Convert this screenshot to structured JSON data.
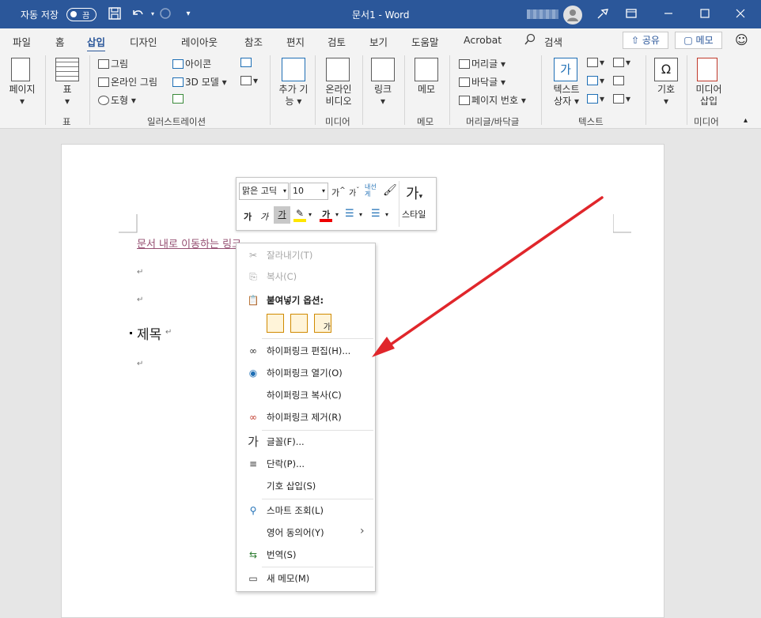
{
  "titlebar": {
    "autosave": "자동 저장",
    "toggle": "끔",
    "title": "문서1  -  Word",
    "bg": "#2b579a"
  },
  "tabs": {
    "items": [
      "파일",
      "홈",
      "삽입",
      "디자인",
      "레이아웃",
      "참조",
      "편지",
      "검토",
      "보기",
      "도움말",
      "Acrobat"
    ],
    "search": "검색",
    "share": "공유",
    "memo": "메모"
  },
  "ribbon": {
    "page": "페이지",
    "table": "표",
    "picture": "그림",
    "online_picture": "온라인 그림",
    "shape": "도형",
    "icons": "아이콘",
    "model3d": "3D 모델",
    "addin_1": "추가 기",
    "addin_2": "능",
    "online_video_1": "온라인",
    "online_video_2": "비디오",
    "link": "링크",
    "comment": "메모",
    "header": "머리글",
    "footer": "바닥글",
    "page_number": "페이지 번호",
    "textbox_1": "텍스트",
    "textbox_2": "상자",
    "symbol": "기호",
    "media_insert_1": "미디어",
    "media_insert_2": "삽입",
    "groups": {
      "table": "표",
      "illustrations": "일러스트레이션",
      "media": "미디어",
      "comments": "메모",
      "header_footer": "머리글/바닥글",
      "text": "텍스트",
      "media2": "미디어"
    }
  },
  "document": {
    "link_text": "문서 내로 이동하는 링크",
    "heading": "제목"
  },
  "minitoolbar": {
    "font": "맑은 고딕",
    "size": "10",
    "styles": "스타일",
    "bold": "가",
    "italic": "가",
    "underline": "가",
    "grow": "가",
    "shrink": "가",
    "phonetic_1": "내선",
    "phonetic_2": "게",
    "font_color_glyph": "가"
  },
  "context_menu": {
    "cut": "잘라내기(T)",
    "copy": "복사(C)",
    "paste_options": "붙여넣기 옵션:",
    "edit_hyperlink": "하이퍼링크 편집(H)...",
    "open_hyperlink": "하이퍼링크 열기(O)",
    "copy_hyperlink": "하이퍼링크 복사(C)",
    "remove_hyperlink": "하이퍼링크 제거(R)",
    "font": "글꼴(F)...",
    "paragraph": "단락(P)...",
    "insert_symbol": "기호 삽입(S)",
    "smart_lookup": "스마트 조회(L)",
    "synonyms": "영어 동의어(Y)",
    "translate": "번역(S)",
    "new_comment": "새 메모(M)"
  },
  "colors": {
    "accent": "#2b579a",
    "arrow": "#e0262b",
    "link": "#954f72"
  }
}
